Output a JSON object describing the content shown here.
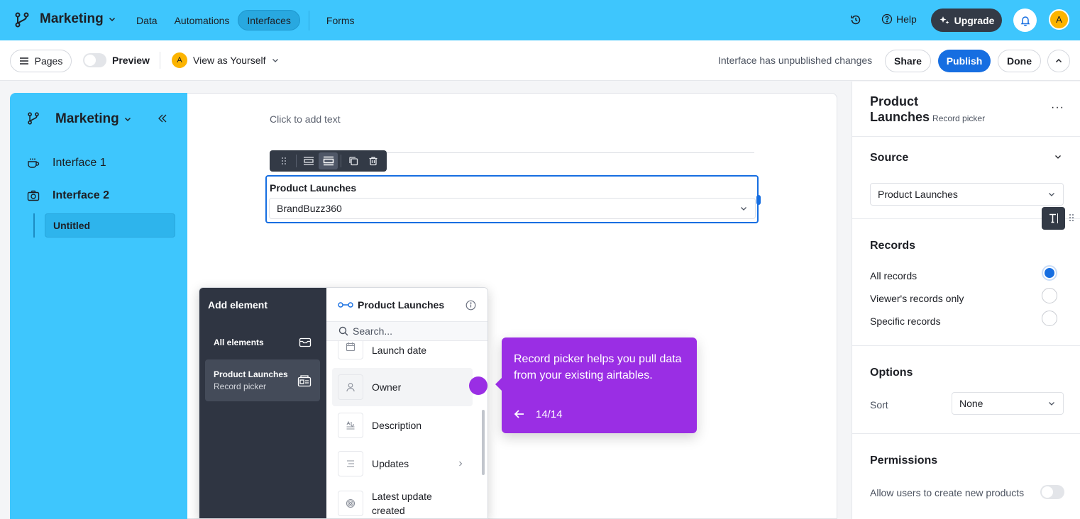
{
  "topbar": {
    "base_name": "Marketing",
    "nav": [
      "Data",
      "Automations",
      "Interfaces",
      "Forms"
    ],
    "active_nav": "Interfaces",
    "help": "Help",
    "upgrade": "Upgrade",
    "avatar_initial": "A"
  },
  "subbar": {
    "pages": "Pages",
    "preview": "Preview",
    "view_as": "View as Yourself",
    "avatar_initial": "A",
    "status": "Interface has unpublished changes",
    "share": "Share",
    "publish": "Publish",
    "done": "Done"
  },
  "sidebar": {
    "base_name": "Marketing",
    "items": [
      {
        "label": "Interface 1",
        "icon": "coffee-cup-icon"
      },
      {
        "label": "Interface 2",
        "icon": "camera-icon"
      }
    ],
    "page": "Untitled"
  },
  "canvas": {
    "placeholder_text": "Click to add text",
    "picker_label": "Product Launches",
    "picker_value": "BrandBuzz360"
  },
  "add_element": {
    "title": "Add element",
    "all_elements": "All elements",
    "category_title": "Product Launches",
    "category_sub": "Record picker",
    "table_name": "Product Launches",
    "search_placeholder": "Search...",
    "fields": [
      {
        "label": "Launch date",
        "icon": "calendar-icon"
      },
      {
        "label": "Owner",
        "icon": "user-icon"
      },
      {
        "label": "Description",
        "icon": "long-text-icon"
      },
      {
        "label": "Updates",
        "icon": "list-icon"
      },
      {
        "label_line1": "Latest update",
        "label_line2": "created",
        "icon": "fingerprint-icon"
      }
    ]
  },
  "tour": {
    "text": "Record picker helps you pull data from your existing airtables.",
    "step": "14/14"
  },
  "right_panel": {
    "title_line1": "Product",
    "title_line2": "Launches",
    "subtitle": "Record picker",
    "source_heading": "Source",
    "source_value": "Product Launches",
    "records_heading": "Records",
    "record_options": [
      "All records",
      "Viewer's records only",
      "Specific records"
    ],
    "selected_record_option": "All records",
    "options_heading": "Options",
    "sort_label": "Sort",
    "sort_value": "None",
    "permissions_heading": "Permissions",
    "permission_label": "Allow users to create new products",
    "permission_enabled": false
  },
  "colors": {
    "brand_blue": "#3ec6fd",
    "accent": "#166ee1",
    "tour_purple": "#9a2ee4",
    "dark_panel": "#2f3542"
  }
}
